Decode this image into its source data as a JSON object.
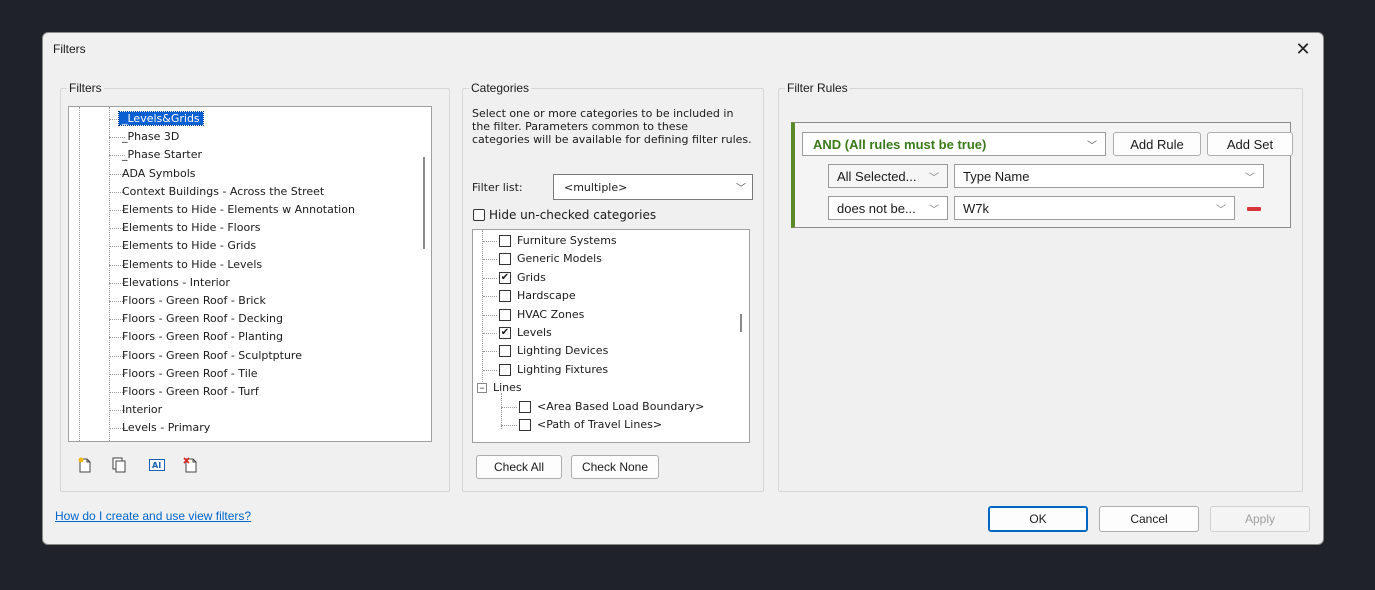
{
  "window": {
    "title": "Filters",
    "close_glyph": "✕"
  },
  "filters_panel": {
    "legend": "Filters",
    "items": [
      "_Levels&Grids",
      "_Phase 3D",
      "_Phase Starter",
      "ADA Symbols",
      "Context Buildings - Across the Street",
      "Elements to Hide - Elements w Annotation",
      "Elements to Hide - Floors",
      "Elements to Hide - Grids",
      "Elements to Hide - Levels",
      "Elevations - Interior",
      "Floors - Green Roof - Brick",
      "Floors - Green Roof - Decking",
      "Floors - Green Roof - Planting",
      "Floors - Green Roof - Sculptpture",
      "Floors - Green Roof - Tile",
      "Floors - Green Roof - Turf",
      "Interior",
      "Levels - Primary"
    ],
    "selected_index": 0,
    "toolbar_icons": [
      "new-filter-icon",
      "duplicate-icon",
      "rename-icon",
      "delete-filter-icon"
    ]
  },
  "categories_panel": {
    "legend": "Categories",
    "description": [
      "Select one or more categories to be included in",
      "the filter.  Parameters common to these",
      "categories will be available for defining filter rules."
    ],
    "filter_list_label": "Filter list:",
    "filter_list_value": "<multiple>",
    "hide_unchecked_label": "Hide un-checked categories",
    "items": [
      {
        "label": "Furniture Systems",
        "checked": false,
        "level": 1
      },
      {
        "label": "Generic Models",
        "checked": false,
        "level": 1
      },
      {
        "label": "Grids",
        "checked": true,
        "level": 1
      },
      {
        "label": "Hardscape",
        "checked": false,
        "level": 1
      },
      {
        "label": "HVAC Zones",
        "checked": false,
        "level": 1
      },
      {
        "label": "Levels",
        "checked": true,
        "level": 1
      },
      {
        "label": "Lighting Devices",
        "checked": false,
        "level": 1
      },
      {
        "label": "Lighting Fixtures",
        "checked": false,
        "level": 1
      },
      {
        "label": "Lines",
        "checked": null,
        "level": 0
      },
      {
        "label": "<Area Based Load Boundary>",
        "checked": false,
        "level": 2
      },
      {
        "label": "<Path of Travel Lines>",
        "checked": false,
        "level": 2
      }
    ],
    "check_all": "Check All",
    "check_none": "Check None"
  },
  "rules_panel": {
    "legend": "Filter Rules",
    "logic": "AND (All rules must be true)",
    "add_rule": "Add Rule",
    "add_set": "Add Set",
    "rule1_param_scope": "All Selected...",
    "rule1_param": "Type Name",
    "rule1_operator": "does not be...",
    "rule1_value": "W7k"
  },
  "footer": {
    "help_link": "How do I create and use view filters?",
    "ok": "OK",
    "cancel": "Cancel",
    "apply": "Apply"
  }
}
